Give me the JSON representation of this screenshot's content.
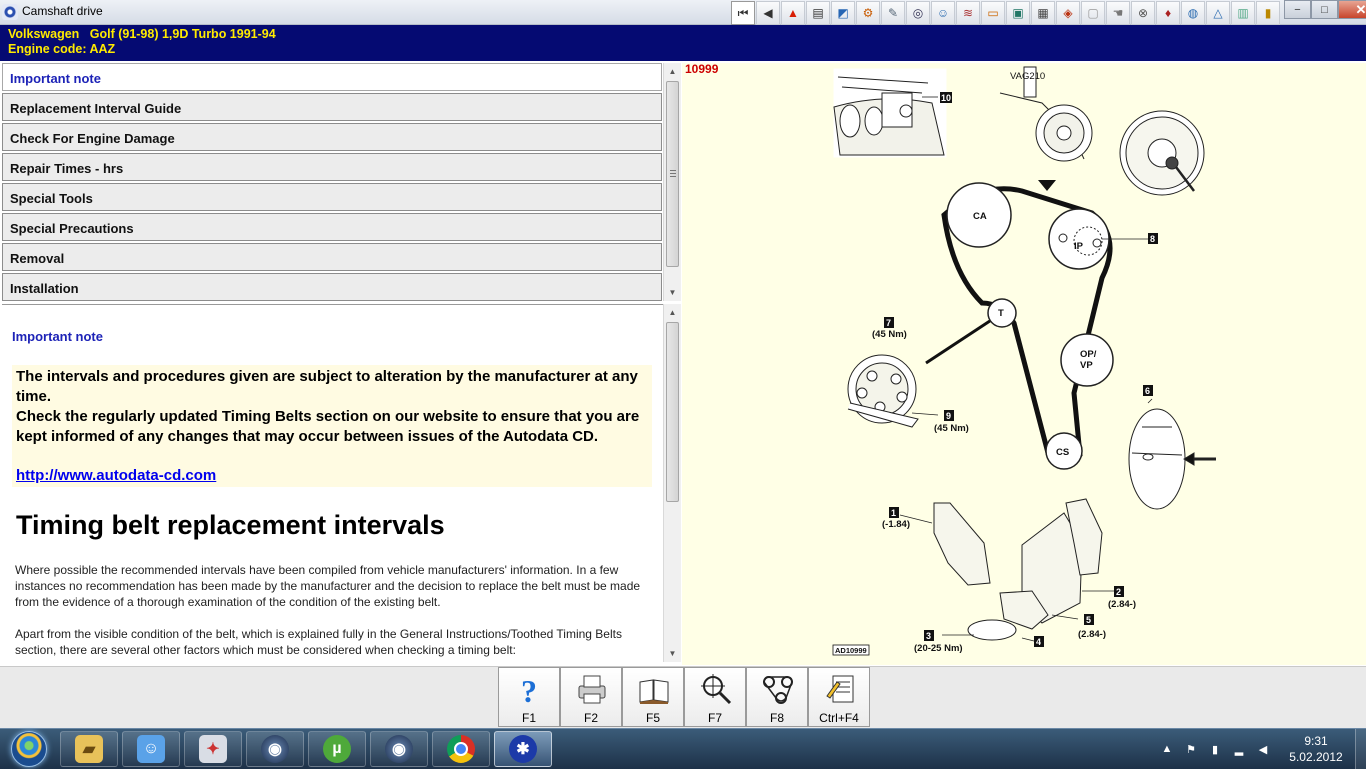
{
  "window": {
    "title": "Camshaft drive",
    "toolbar_icons": [
      "first-page-icon",
      "previous-icon",
      "warning-icon",
      "document-icon",
      "chart-icon",
      "engine-icon",
      "tools-icon",
      "gauge-icon",
      "technician-icon",
      "wiring-icon",
      "fuel-icon",
      "service-icon",
      "battery-icon",
      "settings-icon",
      "blank-icon",
      "hand-icon",
      "timing-icon",
      "oil-icon",
      "caution-icon",
      "vehicle-icon",
      "notes-icon"
    ],
    "controls": {
      "minimize": "−",
      "maximize": "□",
      "close": "✕"
    }
  },
  "header": {
    "vehicle": "Volkswagen   Golf (91-98) 1,9D Turbo 1991-94",
    "engine_code": "Engine code: AAZ"
  },
  "menu": {
    "items": [
      {
        "label": "Important note",
        "active": true
      },
      {
        "label": "Replacement Interval Guide",
        "active": false
      },
      {
        "label": "Check For Engine Damage",
        "active": false
      },
      {
        "label": "Repair Times - hrs",
        "active": false
      },
      {
        "label": "Special Tools",
        "active": false
      },
      {
        "label": "Special Precautions",
        "active": false
      },
      {
        "label": "Removal",
        "active": false
      },
      {
        "label": "Installation",
        "active": false
      }
    ]
  },
  "content": {
    "note_title": "Important note",
    "note_line1": "The intervals and procedures given are subject to alteration by the manufacturer at any time.",
    "note_line2": "Check the regularly updated Timing Belts section on our website to ensure that you are kept informed of any changes that may occur between issues of the Autodata CD.",
    "link": "http://www.autodata-cd.com",
    "heading": "Timing belt replacement intervals",
    "paragraph1": "Where possible the recommended intervals have been compiled from vehicle manufacturers' information. In a few instances no recommendation has been made by the manufacturer and the decision to replace the belt must be made from the evidence of a thorough examination of the condition of the existing belt.",
    "paragraph2": "Apart from the visible condition of the belt, which is explained fully in the General Instructions/Toothed Timing Belts section, there are several other factors which must be considered when checking a timing belt:"
  },
  "diagram": {
    "ref_number": "10999",
    "figure_code": "AD10999",
    "tool_label": "VAG210",
    "pulleys": {
      "ca": "CA",
      "ip": "IP",
      "t": "T",
      "op_vp": "OP/\nVP",
      "cs": "CS"
    },
    "callouts": {
      "c1": "1",
      "c1_value": "(-1.84)",
      "c2": "2",
      "c2_value": "(2.84-)",
      "c3": "3",
      "c3_value": "(20-25 Nm)",
      "c4": "4",
      "c5": "5",
      "c5_value": "(2.84-)",
      "c6": "6",
      "c7": "7",
      "c7_value": "(45 Nm)",
      "c8": "8",
      "c9": "9",
      "c9_value": "(45 Nm)",
      "c10": "10"
    }
  },
  "function_keys": [
    {
      "label": "F1",
      "icon": "help-icon"
    },
    {
      "label": "F2",
      "icon": "printer-icon"
    },
    {
      "label": "F5",
      "icon": "book-icon"
    },
    {
      "label": "F7",
      "icon": "magnifier-icon"
    },
    {
      "label": "F8",
      "icon": "timing-belt-icon"
    },
    {
      "label": "Ctrl+F4",
      "icon": "notes-icon"
    }
  ],
  "taskbar": {
    "apps": [
      "explorer-icon",
      "messenger-icon",
      "satellite-icon",
      "browser-icon",
      "utorrent-icon",
      "browser2-icon",
      "chrome-icon",
      "autodata-icon"
    ],
    "clock_time": "9:31",
    "clock_date": "5.02.2012"
  },
  "colors": {
    "header_bg": "#050a72",
    "header_text": "#ffeb00",
    "active_menu_text": "#1d23b7",
    "diagram_bg": "#ffffe6",
    "ref_red": "#cc0000"
  }
}
